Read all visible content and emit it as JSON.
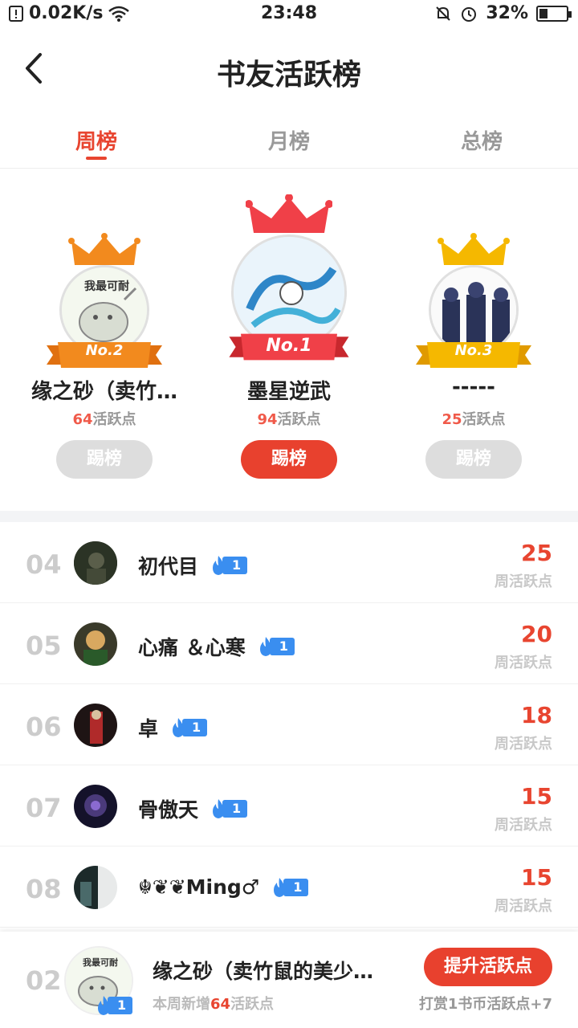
{
  "status_bar": {
    "net_speed": "0.02K/s",
    "time": "23:48",
    "battery": "32%",
    "battery_level": 0.32
  },
  "header": {
    "title": "书友活跃榜"
  },
  "tabs": [
    {
      "label": "周榜",
      "active": true
    },
    {
      "label": "月榜",
      "active": false
    },
    {
      "label": "总榜",
      "active": false
    }
  ],
  "podium": {
    "first": {
      "badge": "No.1",
      "name": "墨星逆武",
      "points": "94",
      "points_suffix": "活跃点",
      "button": "踢榜"
    },
    "second": {
      "badge": "No.2",
      "name": "缘之砂（卖竹…",
      "points": "64",
      "points_suffix": "活跃点",
      "button": "踢榜"
    },
    "third": {
      "badge": "No.3",
      "name": "-----",
      "points": "25",
      "points_suffix": "活跃点",
      "button": "踢榜"
    }
  },
  "list": [
    {
      "rank": "04",
      "name": "初代目",
      "level": "1",
      "score": "25",
      "score_label": "周活跃点"
    },
    {
      "rank": "05",
      "name": "心痛 ＆心寒",
      "level": "1",
      "score": "20",
      "score_label": "周活跃点"
    },
    {
      "rank": "06",
      "name": "卓",
      "level": "1",
      "score": "18",
      "score_label": "周活跃点"
    },
    {
      "rank": "07",
      "name": "骨傲天",
      "level": "1",
      "score": "15",
      "score_label": "周活跃点"
    },
    {
      "rank": "08",
      "name": "☬❦❦Ming♂",
      "level": "1",
      "score": "15",
      "score_label": "周活跃点"
    }
  ],
  "me": {
    "rank": "02",
    "name": "缘之砂（卖竹鼠的美少…",
    "level": "1",
    "weekly_prefix": "本周新增",
    "weekly_points": "64",
    "weekly_suffix": "活跃点",
    "boost_button": "提升活跃点",
    "tip": "打赏1书币活跃点+7"
  },
  "colors": {
    "accent": "#e84530",
    "gold": "#f5b800",
    "silver_orange": "#f28a1e",
    "level_blue": "#3a8ef0"
  }
}
